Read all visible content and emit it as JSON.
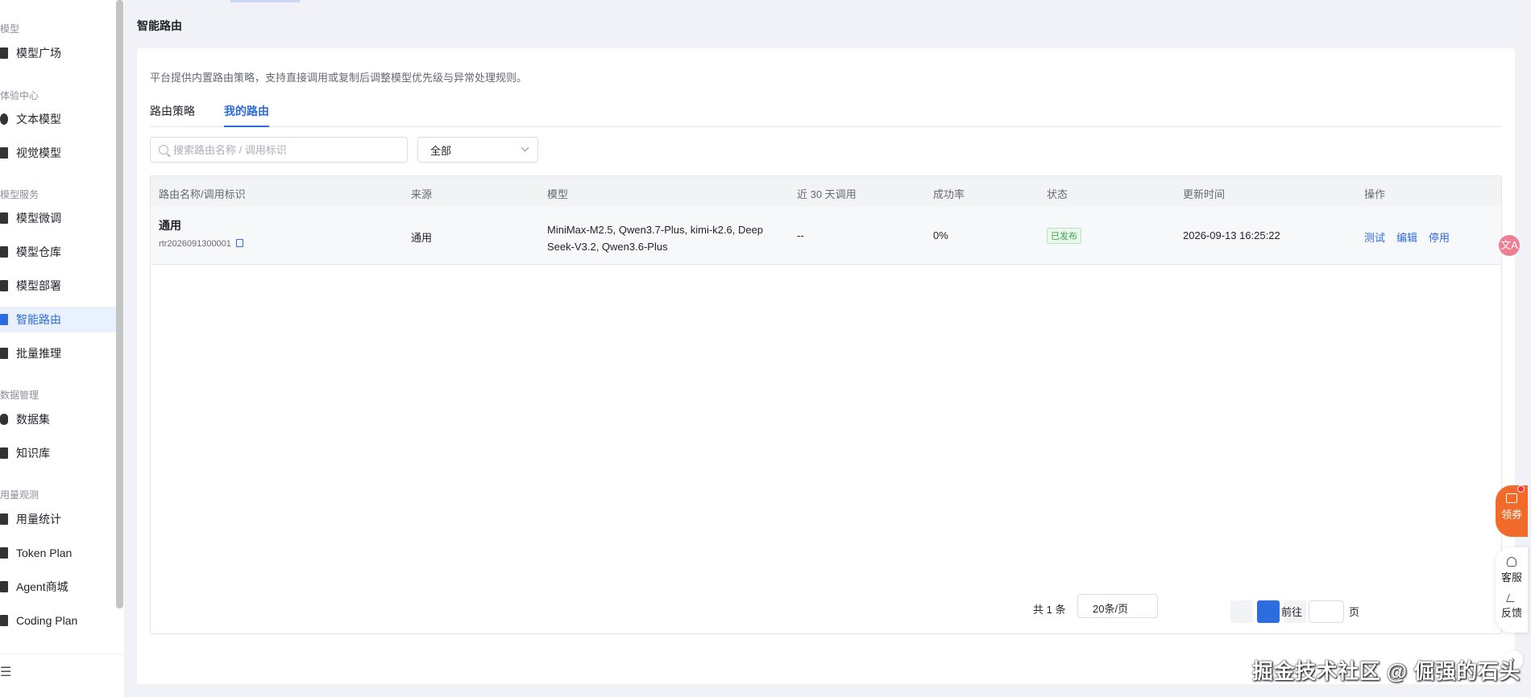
{
  "sidebar": {
    "groups": [
      {
        "label": "模型"
      },
      {
        "label": "体验中心"
      },
      {
        "label": "模型服务"
      },
      {
        "label": "数据管理"
      },
      {
        "label": "用量观测"
      }
    ],
    "items": [
      {
        "label": "模型广场",
        "icon": "cube-icon"
      },
      {
        "label": "文本模型",
        "icon": "chat-icon"
      },
      {
        "label": "视觉模型",
        "icon": "camera-icon"
      },
      {
        "label": "模型微调",
        "icon": "tune-icon"
      },
      {
        "label": "模型仓库",
        "icon": "storage-icon"
      },
      {
        "label": "模型部署",
        "icon": "rocket-icon"
      },
      {
        "label": "智能路由",
        "icon": "route-icon",
        "active": true
      },
      {
        "label": "批量推理",
        "icon": "batch-icon"
      },
      {
        "label": "数据集",
        "icon": "database-icon"
      },
      {
        "label": "知识库",
        "icon": "book-icon"
      },
      {
        "label": "用量统计",
        "icon": "bar-chart-icon"
      },
      {
        "label": "Token Plan",
        "icon": "gift-icon"
      },
      {
        "label": "Agent商城",
        "icon": "robot-icon"
      },
      {
        "label": "Coding Plan",
        "icon": "code-icon"
      }
    ],
    "footer_icon": "☰"
  },
  "page": {
    "title": "智能路由",
    "description": "平台提供内置路由策略，支持直接调用或复制后调整模型优先级与异常处理规则。"
  },
  "tabs": [
    {
      "label": "路由策略",
      "active": false
    },
    {
      "label": "我的路由",
      "active": true
    }
  ],
  "filters": {
    "search_placeholder": "搜索路由名称 / 调用标识",
    "search_value": "",
    "select_value": "全部"
  },
  "table": {
    "headers": [
      "路由名称/调用标识",
      "来源",
      "模型",
      "近 30 天调用",
      "成功率",
      "状态",
      "更新时间",
      "操作"
    ],
    "rows": [
      {
        "name": "通用",
        "id": "rtr2026091300001",
        "source": "通用",
        "models_line1": "MiniMax-M2.5, Qwen3.7-Plus, kimi-k2.6, Deep",
        "models_line2": "Seek-V3.2, Qwen3.6-Plus",
        "calls_30d": "--",
        "success_rate": "0%",
        "status": "已发布",
        "updated_at": "2026-09-13 16:25:22",
        "actions": [
          "测试",
          "编辑",
          "停用"
        ]
      }
    ]
  },
  "pagination": {
    "total_text": "共 1 条",
    "page_size": "20条/页",
    "current_page": 1,
    "jump_label": "前往",
    "page_unit": "页"
  },
  "widgets": {
    "translate_glyph": "文A",
    "coupon_label": "领券",
    "service_label": "客服",
    "feedback_label": "反馈",
    "collapse_glyph": "›"
  },
  "watermark": "掘金技术社区 @ 倔强的石头_",
  "colors": {
    "accent": "#2d6cdf",
    "status_green": "#3aa54a",
    "coupon_orange": "#f26a2a"
  }
}
